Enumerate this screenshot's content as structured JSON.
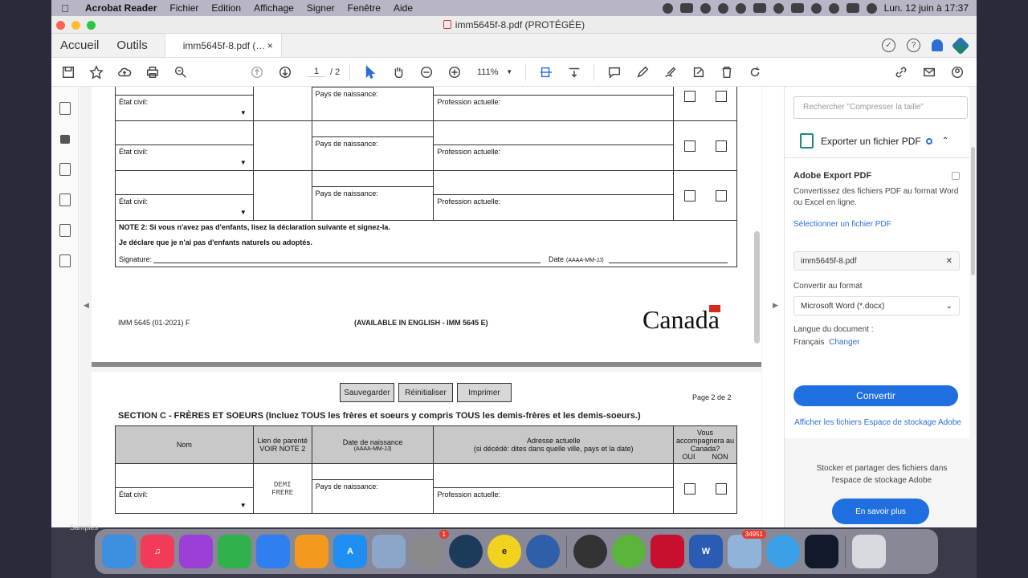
{
  "menubar": {
    "app": "Acrobat Reader",
    "items": [
      "Fichier",
      "Edition",
      "Affichage",
      "Signer",
      "Fenêtre",
      "Aide"
    ],
    "clock": "Lun. 12 juin à 17:37"
  },
  "window": {
    "title": "imm5645f-8.pdf (PROTÉGÉE)"
  },
  "tabs": {
    "home": "Accueil",
    "tools": "Outils",
    "doc": "imm5645f-8.pdf (…",
    "close": "×"
  },
  "toolbar": {
    "page_current": "1",
    "page_total": "/ 2",
    "zoom": "111%"
  },
  "page1": {
    "rows": [
      {
        "etat": "État civil:",
        "pays": "Pays de naissance:",
        "prof": "Profession actuelle:"
      },
      {
        "etat": "État civil:",
        "pays": "Pays de naissance:",
        "prof": "Profession actuelle:"
      },
      {
        "etat": "État civil:",
        "pays": "Pays de naissance:",
        "prof": "Profession actuelle:"
      }
    ],
    "note2": "NOTE 2: Si vous n'avez pas d'enfants, lisez la déclaration suivante et signez-la.",
    "declare": "Je déclare que je n'ai pas d'enfants naturels ou adoptés.",
    "signature": "Signature:",
    "date": "Date",
    "date_fmt": "(AAAA-MM-JJ)",
    "form_code": "IMM 5645 (01-2021) F",
    "english": "(AVAILABLE IN ENGLISH - IMM 5645 E)",
    "canada": "Canada"
  },
  "page2": {
    "buttons": [
      "Sauvegarder",
      "Réinitialiser",
      "Imprimer"
    ],
    "page_label": "Page 2 de 2",
    "section_title": "SECTION C - FRÈRES ET SOEURS (Incluez TOUS les frères et soeurs y compris TOUS les demis-frères et les demis-soeurs.)",
    "headers": {
      "nom": "Nom",
      "lien": "Lien de parenté VOIR NOTE 2",
      "date": "Date de naissance",
      "date_fmt": "(AAAA-MM-JJ)",
      "adresse": "Adresse actuelle",
      "adresse_sub": "(si décédé: dites dans quelle ville, pays et la date)",
      "accomp": "Vous accompagnera au Canada?",
      "oui": "OUI",
      "non": "NON"
    },
    "row": {
      "etat": "État civil:",
      "lien": "DEMI FRERE",
      "pays": "Pays de naissance:",
      "prof": "Profession actuelle:"
    }
  },
  "rightpanel": {
    "search_placeholder": "Rechercher \"Compresser la taille\"",
    "section_title": "Exporter un fichier PDF",
    "export_heading": "Adobe Export PDF",
    "export_desc": "Convertissez des fichiers PDF au format Word ou Excel en ligne.",
    "select_file": "Sélectionner un fichier PDF",
    "file_name": "imm5645f-8.pdf",
    "convert_to": "Convertir au format",
    "format": "Microsoft Word (*.docx)",
    "lang_label": "Langue du document :",
    "lang_value": "Français",
    "lang_change": "Changer",
    "convert_btn": "Convertir",
    "storage_link": "Afficher les fichiers Espace de stockage Adobe",
    "store_text": "Stocker et partager des fichiers dans l'espace de stockage Adobe",
    "learn_more": "En savoir plus"
  },
  "dock": {
    "samples": "Samples",
    "settings_badge": "1",
    "mail_badge": "34951"
  }
}
